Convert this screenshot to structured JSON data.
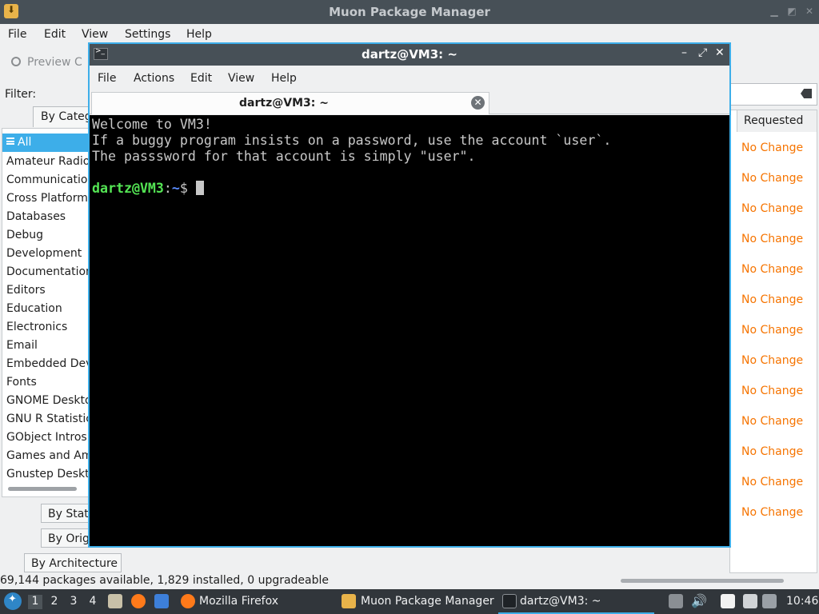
{
  "muon": {
    "title": "Muon Package Manager",
    "menu": [
      "File",
      "Edit",
      "View",
      "Settings",
      "Help"
    ],
    "preview_label": "Preview C",
    "filter_label": "Filter:",
    "tab_by_category": "By Categ",
    "categories": [
      "All",
      "Amateur Radio",
      "Communication",
      "Cross Platform",
      "Databases",
      "Debug",
      "Development",
      "Documentation",
      "Editors",
      "Education",
      "Electronics",
      "Email",
      "Embedded Dev",
      "Fonts",
      "GNOME Deskto",
      "GNU R Statistic",
      "GObject Introsp",
      "Games and Amu",
      "Gnustep Deskto"
    ],
    "tab_by_status": "By Stat",
    "tab_by_origin": "By Orig",
    "tab_by_architecture": "By Architecture",
    "requested_header": "Requested",
    "requested_values": [
      "No Change",
      "No Change",
      "No Change",
      "No Change",
      "No Change",
      "No Change",
      "No Change",
      "No Change",
      "No Change",
      "No Change",
      "No Change",
      "No Change",
      "No Change"
    ],
    "status": "69,144 packages available, 1,829 installed, 0 upgradeable"
  },
  "terminal": {
    "title": "dartz@VM3: ~",
    "menu": [
      "File",
      "Actions",
      "Edit",
      "View",
      "Help"
    ],
    "tab_label": "dartz@VM3: ~",
    "lines": [
      "Welcome to VM3!",
      "If a buggy program insists on a password, use the account `user`.",
      "The passsword for that account is simply \"user\"."
    ],
    "prompt_user": "dartz@VM3",
    "prompt_sep": ":",
    "prompt_path": "~",
    "prompt_symbol": "$ "
  },
  "taskbar": {
    "workspaces": [
      "1",
      "2",
      "3",
      "4"
    ],
    "tasks": [
      "Mozilla Firefox",
      "Muon Package Manager",
      "dartz@VM3: ~"
    ],
    "clock": "10:46"
  },
  "colors": {
    "accent": "#3daee9",
    "no_change": "#f67400",
    "prompt_user": "#54e554",
    "prompt_path": "#5a8cff"
  }
}
